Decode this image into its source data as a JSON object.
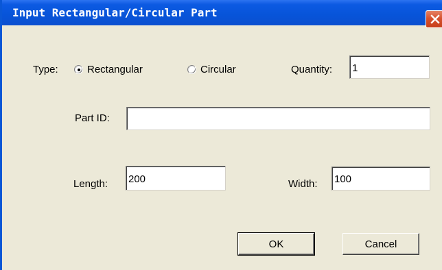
{
  "window": {
    "title": "Input Rectangular/Circular Part"
  },
  "form": {
    "type_label": "Type:",
    "type_options": [
      {
        "label": "Rectangular",
        "selected": true
      },
      {
        "label": "Circular",
        "selected": false
      }
    ],
    "quantity_label": "Quantity:",
    "quantity_value": "1",
    "part_id_label": "Part ID:",
    "part_id_value": "",
    "length_label": "Length:",
    "length_value": "200",
    "width_label": "Width:",
    "width_value": "100"
  },
  "buttons": {
    "ok_label": "OK",
    "cancel_label": "Cancel"
  },
  "colors": {
    "titlebar": "#0754d9",
    "close_button": "#d6512e",
    "dialog_background": "#ece9d8"
  },
  "icons": {
    "close": "close-icon"
  }
}
